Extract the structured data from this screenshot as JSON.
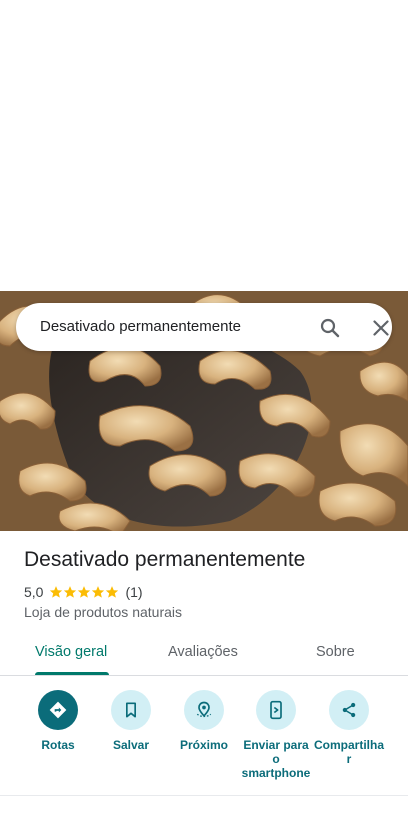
{
  "search": {
    "value": "Desativado permanentemente"
  },
  "place": {
    "title": "Desativado permanentemente",
    "rating": "5,0",
    "review_count": "(1)",
    "stars": 5,
    "category": "Loja de produtos naturais"
  },
  "tabs": [
    {
      "label": "Visão geral",
      "active": true
    },
    {
      "label": "Avaliações",
      "active": false
    },
    {
      "label": "Sobre",
      "active": false
    }
  ],
  "actions": [
    {
      "label": "Rotas",
      "icon": "directions-icon"
    },
    {
      "label": "Salvar",
      "icon": "bookmark-icon"
    },
    {
      "label": "Próximo",
      "icon": "nearby-icon"
    },
    {
      "label": "Enviar para o smartphone",
      "icon": "send-to-phone-icon"
    },
    {
      "label": "Compartilhar",
      "icon": "share-icon"
    }
  ],
  "colors": {
    "accent": "#00796b",
    "action_bg": "#d2eff5",
    "action_primary": "#0b6c7a",
    "star": "#fbbc04"
  }
}
